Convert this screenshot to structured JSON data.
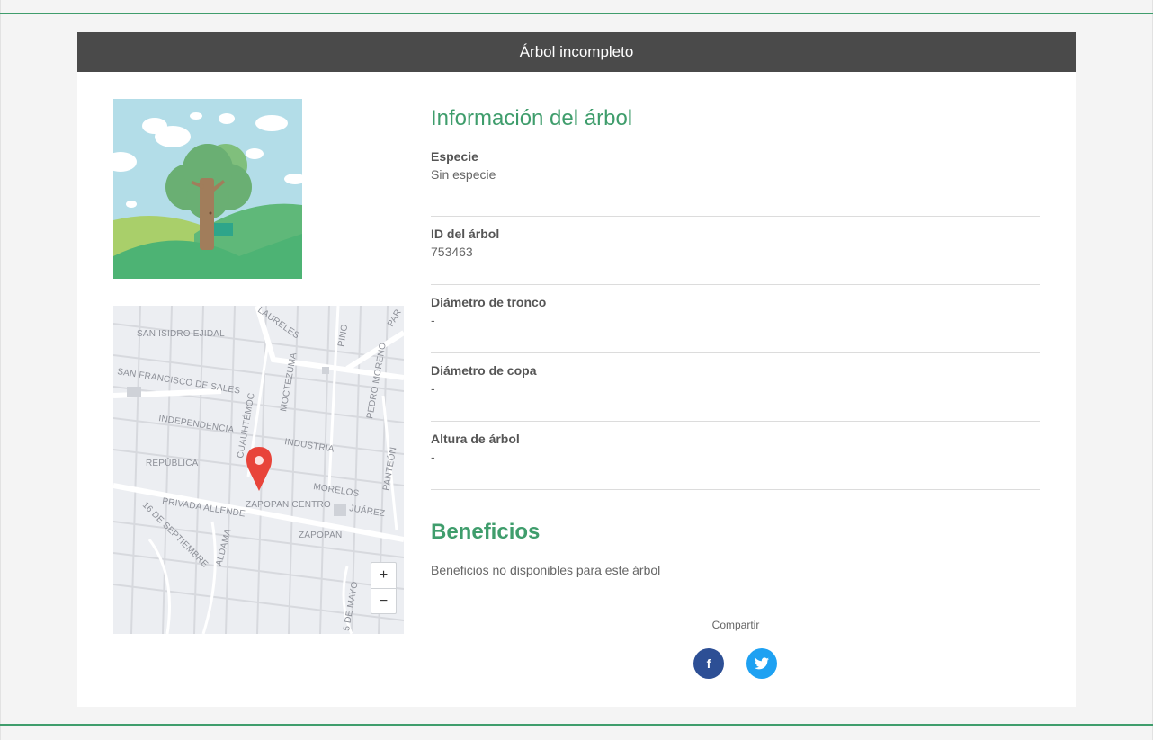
{
  "header": {
    "title": "Árbol incompleto"
  },
  "info": {
    "title": "Información del árbol",
    "fields": [
      {
        "label": "Especie",
        "value": "Sin especie"
      },
      {
        "label": "ID del árbol",
        "value": "753463"
      },
      {
        "label": "Diámetro de tronco",
        "value": "-"
      },
      {
        "label": "Diámetro de copa",
        "value": "-"
      },
      {
        "label": "Altura de árbol",
        "value": "-"
      }
    ]
  },
  "benefits": {
    "title": "Beneficios",
    "text": "Beneficios no disponibles para este árbol"
  },
  "share": {
    "label": "Compartir",
    "facebook_icon": "f"
  },
  "map": {
    "zoom_in": "+",
    "zoom_out": "−",
    "labels": [
      "SAN ISIDRO EJIDAL",
      "SAN FRANCISCO DE SALES",
      "INDEPENDENCIA",
      "REPÚBLICA",
      "PRIVADA ALLENDE",
      "ZAPOPAN CENTRO",
      "ZAPOPAN",
      "MORELOS",
      "JUÁREZ",
      "INDUSTRIA",
      "CUAUHTÉMOC",
      "MOCTEZUMA",
      "PEDRO MORENO",
      "PANTEÓN",
      "PINO",
      "PAR",
      "LAURELES",
      "16 DE SEPTIEMBRE",
      "ALDAMA",
      "5 DE MAYO"
    ]
  },
  "colors": {
    "accent": "#3f9d6c",
    "header_bg": "#4a4a4a",
    "facebook": "#2d4f95",
    "twitter": "#1ea1f2",
    "pin": "#e8443a"
  }
}
